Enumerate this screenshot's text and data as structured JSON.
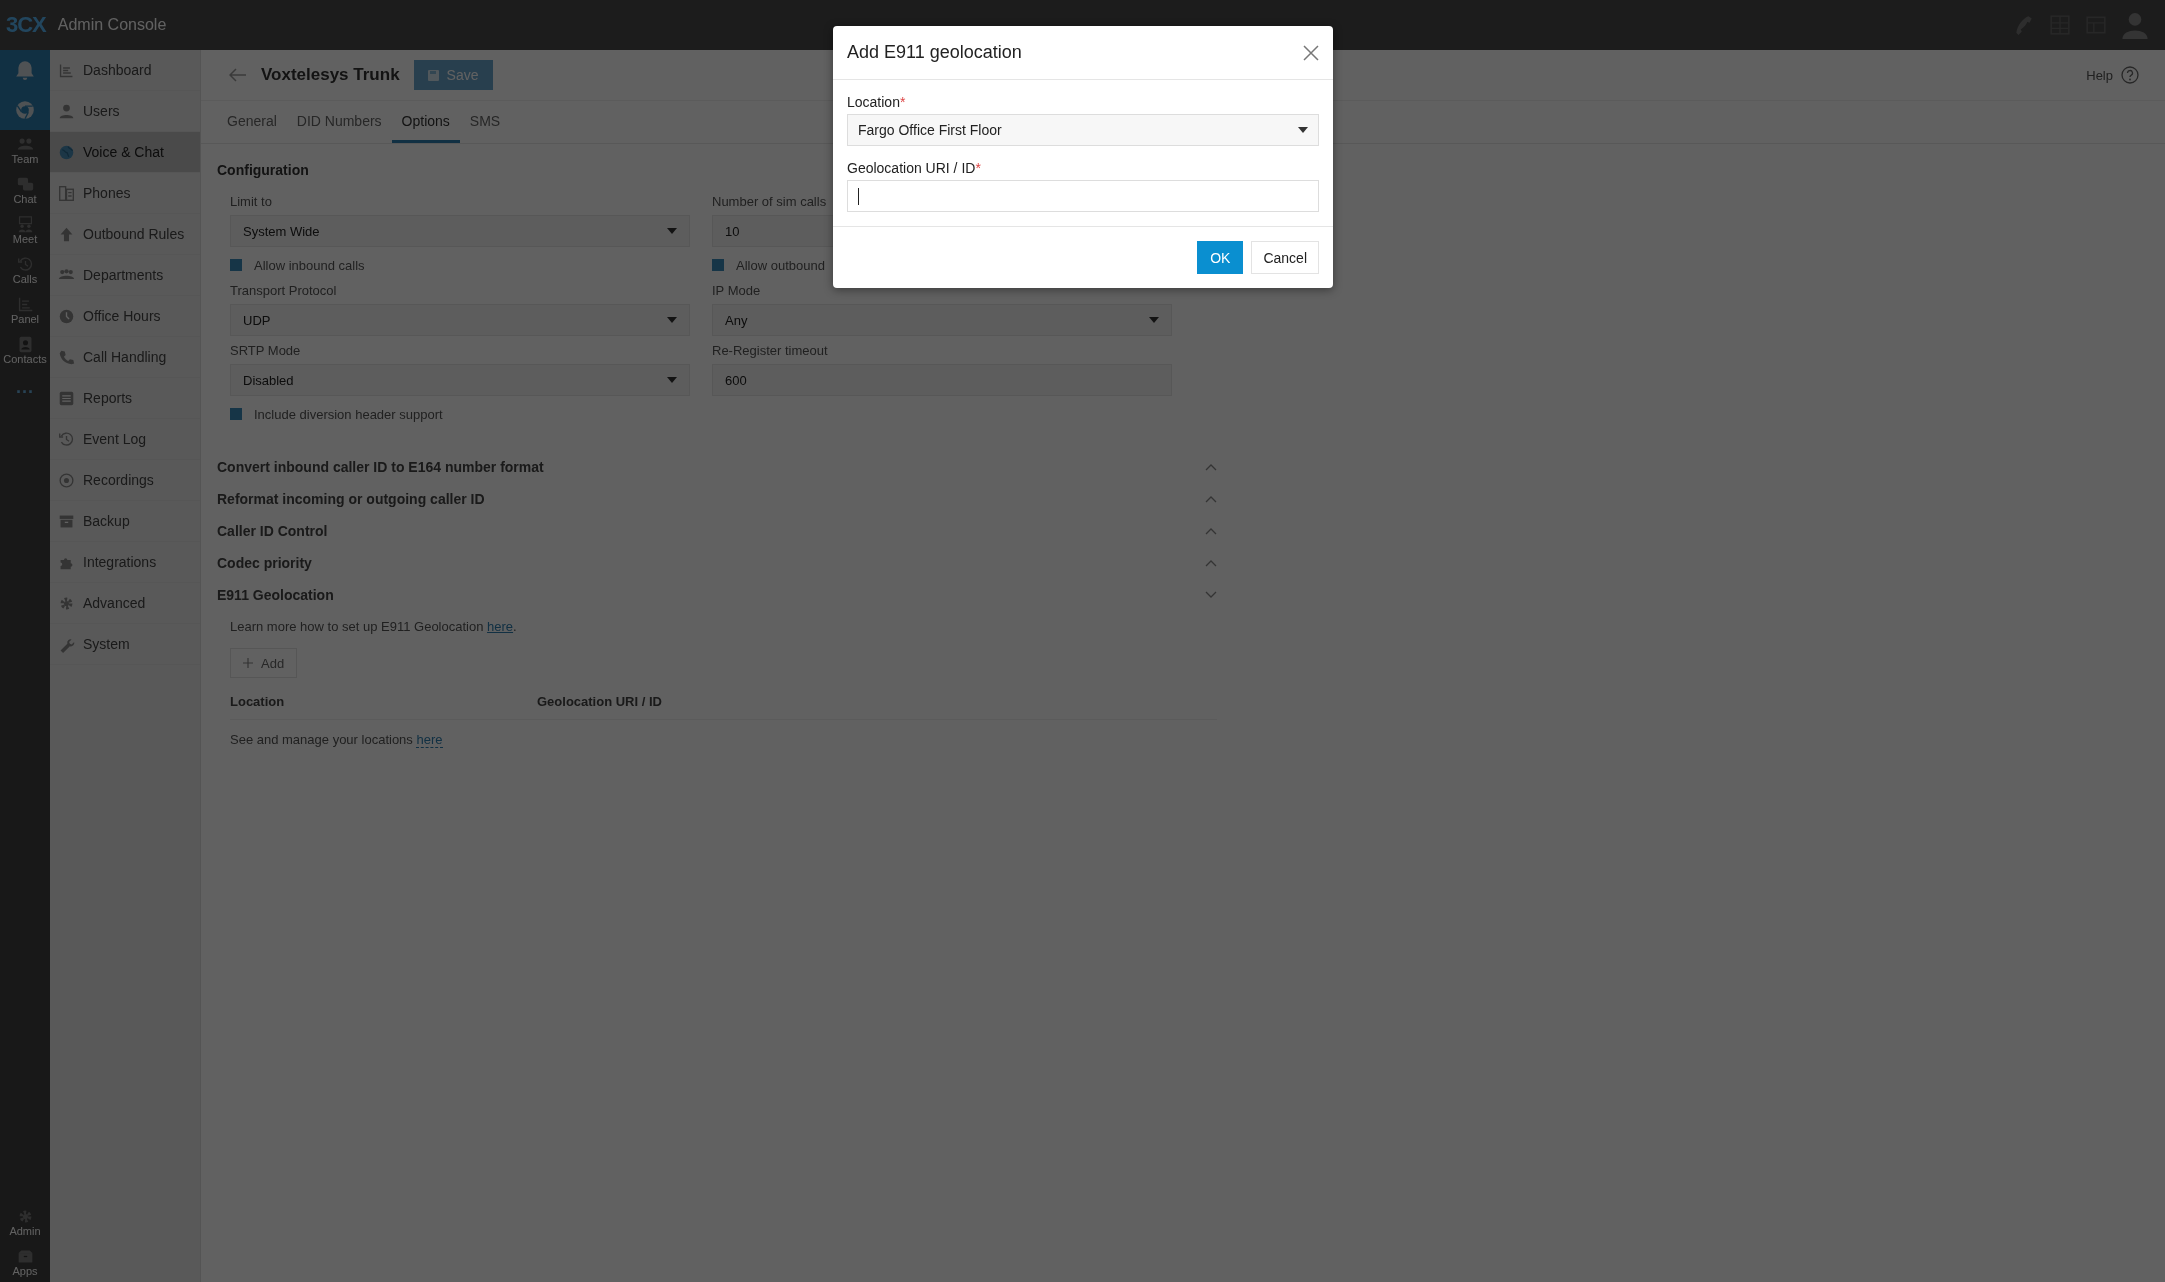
{
  "topbar": {
    "logo": "3CX",
    "title": "Admin Console"
  },
  "rail": {
    "items": [
      {
        "selected": true
      },
      {
        "selected": true
      },
      {
        "label": "Team",
        "selected": false
      },
      {
        "label": "Chat",
        "selected": false
      },
      {
        "label": "Meet",
        "selected": false
      },
      {
        "label": "Calls",
        "selected": false
      },
      {
        "label": "Panel",
        "selected": false
      },
      {
        "label": "Contacts",
        "selected": false
      }
    ],
    "more": "···",
    "bottom": [
      {
        "label": "Admin"
      },
      {
        "label": "Apps"
      }
    ]
  },
  "sidebar": {
    "items": [
      {
        "label": "Dashboard",
        "selected": false
      },
      {
        "label": "Users",
        "selected": false
      },
      {
        "label": "Voice & Chat",
        "selected": true
      },
      {
        "label": "Phones",
        "selected": false
      },
      {
        "label": "Outbound Rules",
        "selected": false
      },
      {
        "label": "Departments",
        "selected": false
      },
      {
        "label": "Office Hours",
        "selected": false
      },
      {
        "label": "Call Handling",
        "selected": false
      },
      {
        "label": "Reports",
        "selected": false
      },
      {
        "label": "Event Log",
        "selected": false
      },
      {
        "label": "Recordings",
        "selected": false
      },
      {
        "label": "Backup",
        "selected": false
      },
      {
        "label": "Integrations",
        "selected": false
      },
      {
        "label": "Advanced",
        "selected": false
      },
      {
        "label": "System",
        "selected": false
      }
    ]
  },
  "page": {
    "title": "Voxtelesys Trunk",
    "save_button": "Save",
    "help": "Help",
    "tabs": [
      {
        "label": "General",
        "selected": false
      },
      {
        "label": "DID Numbers",
        "selected": false
      },
      {
        "label": "Options",
        "selected": true
      },
      {
        "label": "SMS",
        "selected": false
      }
    ],
    "configuration": {
      "heading": "Configuration",
      "rows": [
        [
          {
            "kind": "select",
            "label": "Limit to",
            "value": "System Wide"
          },
          {
            "kind": "input",
            "label": "Number of sim calls",
            "value": "10"
          }
        ],
        [
          {
            "kind": "checkbox",
            "label": "Allow inbound calls",
            "checked": true
          },
          {
            "kind": "checkbox",
            "label": "Allow outbound",
            "checked": true
          }
        ],
        [
          {
            "kind": "select",
            "label": "Transport Protocol",
            "value": "UDP"
          },
          {
            "kind": "select",
            "label": "IP Mode",
            "value": "Any"
          }
        ],
        [
          {
            "kind": "select",
            "label": "SRTP Mode",
            "value": "Disabled"
          },
          {
            "kind": "input",
            "label": "Re-Register timeout",
            "value": "600"
          }
        ],
        [
          {
            "kind": "checkbox",
            "label": "Include diversion header support",
            "checked": true
          }
        ]
      ]
    },
    "sections": [
      {
        "title": "Convert inbound caller ID to E164 number format",
        "expanded": false
      },
      {
        "title": "Reformat incoming or outgoing caller ID",
        "expanded": false
      },
      {
        "title": "Caller ID Control",
        "expanded": false
      },
      {
        "title": "Codec priority",
        "expanded": false
      },
      {
        "title": "E911 Geolocation",
        "expanded": true
      }
    ],
    "geolocation": {
      "info": "Learn more how to set up E911 Geolocation",
      "info_link": "here",
      "info_end": ".",
      "add_button": "Add",
      "columns": [
        "Location",
        "Geolocation URI / ID"
      ],
      "footer": "See and manage your locations",
      "footer_link": "here"
    }
  },
  "dialog": {
    "title": "Add E911 geolocation",
    "fields": [
      {
        "kind": "select",
        "label": "Location",
        "required_mark": "*",
        "value": "Fargo Office First Floor"
      },
      {
        "kind": "input",
        "label": "Geolocation URI / ID",
        "required_mark": "*",
        "focused": true
      }
    ],
    "ok_button": "OK",
    "cancel_button": "Cancel"
  }
}
